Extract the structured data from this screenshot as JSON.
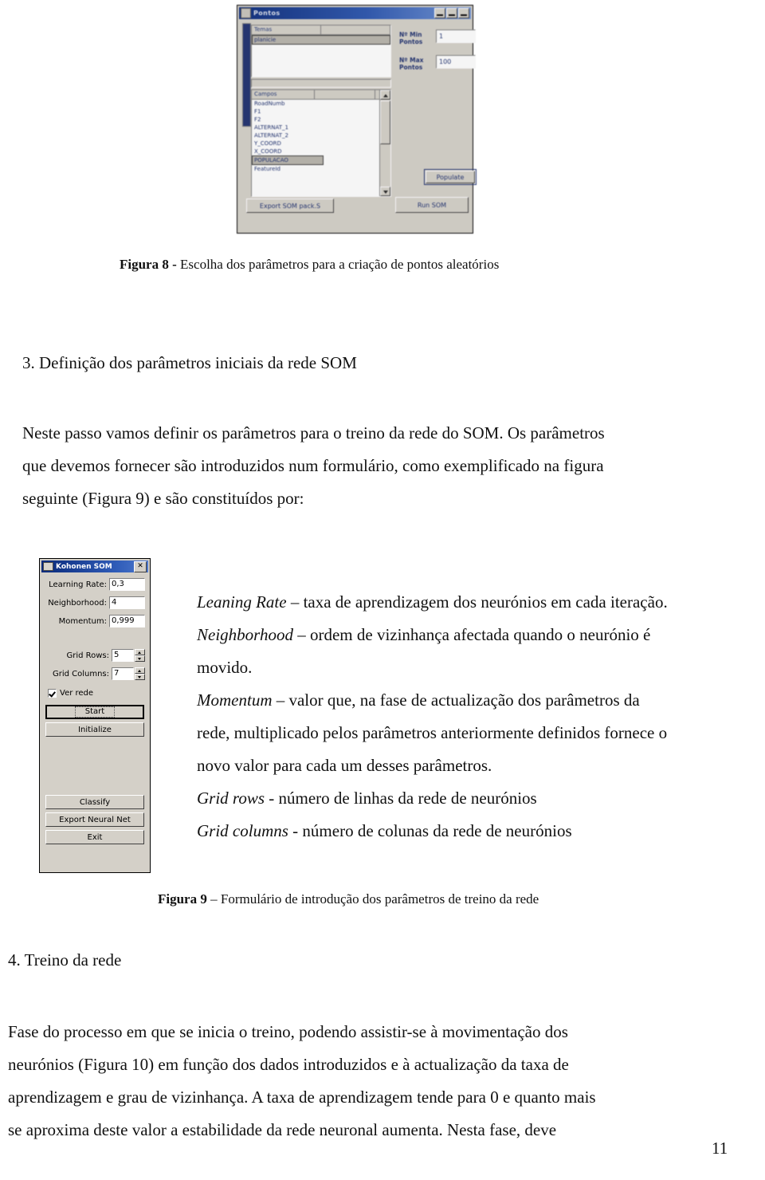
{
  "figure8": {
    "window_title": "Pontos",
    "window_buttons": [
      "minimize",
      "maximize",
      "close"
    ],
    "themes_header": "Temas",
    "themes_items": [
      "planicie"
    ],
    "fields_header": "Campos",
    "fields_items": [
      "RoadNumb",
      "F1",
      "F2",
      "ALTERNAT_1",
      "ALTERNAT_2",
      "Y_COORD",
      "X_COORD",
      "POPULACAO",
      "FeatureId"
    ],
    "fields_selected": "POPULACAO",
    "min_points_label": "Nº Min\nPontos",
    "min_points_value": "1",
    "max_points_label": "Nº Max\nPontos",
    "max_points_value": "100",
    "populate_button": "Populate",
    "export_button": "Export SOM pack.S",
    "run_button": "Run SOM",
    "caption_prefix": "Figura 8 - ",
    "caption_text": "Escolha dos parâmetros para a criação de pontos aleatórios"
  },
  "section3": {
    "heading": "3. Definição dos parâmetros iniciais da rede SOM",
    "paragraph_line1": "Neste passo vamos definir os parâmetros para o treino da rede do SOM. Os parâmetros",
    "paragraph_line2": "que devemos fornecer são introduzidos num formulário, como exemplificado na figura",
    "paragraph_line3": "seguinte (Figura 9) e são constituídos por:"
  },
  "figure9": {
    "window_title": "Kohonen SOM",
    "close_label": "✕",
    "fields": [
      {
        "label": "Learning Rate:",
        "value": "0,3"
      },
      {
        "label": "Neighborhood:",
        "value": "4"
      },
      {
        "label": "Momentum:",
        "value": "0,999"
      }
    ],
    "grid_rows_label": "Grid Rows:",
    "grid_rows_value": "5",
    "grid_columns_label": "Grid Columns:",
    "grid_columns_value": "7",
    "checkbox_label": "Ver rede",
    "checkbox_checked": true,
    "buttons": [
      "Start",
      "Initialize",
      "Classify",
      "Export Neural Net",
      "Exit"
    ],
    "caption_prefix": "Figura 9 ",
    "caption_text": "– Formulário de introdução dos parâmetros de treino da rede"
  },
  "definitions": {
    "d1_term": "Leaning Rate",
    "d1_body": " – taxa de aprendizagem dos neurónios em cada iteração.",
    "d2_term": "Neighborhood",
    "d2_body": " – ordem de vizinhança afectada quando o neurónio é",
    "d2_body2": "movido.",
    "d3_term": "Momentum",
    "d3_body": " – valor que, na fase de actualização dos parâmetros da",
    "d3_body2": "rede, multiplicado pelos parâmetros anteriormente definidos fornece o",
    "d3_body3": "novo valor para cada um desses parâmetros.",
    "d4_term": "Grid rows",
    "d4_body": "  - número de linhas da rede de neurónios",
    "d5_term": "Grid columns",
    "d5_body": " - número de colunas da rede de neurónios"
  },
  "section4": {
    "heading": "4. Treino da rede",
    "paragraph_line1": "Fase do processo em que se inicia o treino, podendo assistir-se à movimentação dos",
    "paragraph_line2": "neurónios (Figura 10) em função dos dados introduzidos e à actualização da taxa de",
    "paragraph_line3": "aprendizagem e grau de vizinhança. A taxa de aprendizagem tende para 0 e quanto mais",
    "paragraph_line4": "se aproxima deste valor a estabilidade da rede neuronal aumenta. Nesta fase, deve"
  },
  "footer": {
    "page_number": "11"
  }
}
